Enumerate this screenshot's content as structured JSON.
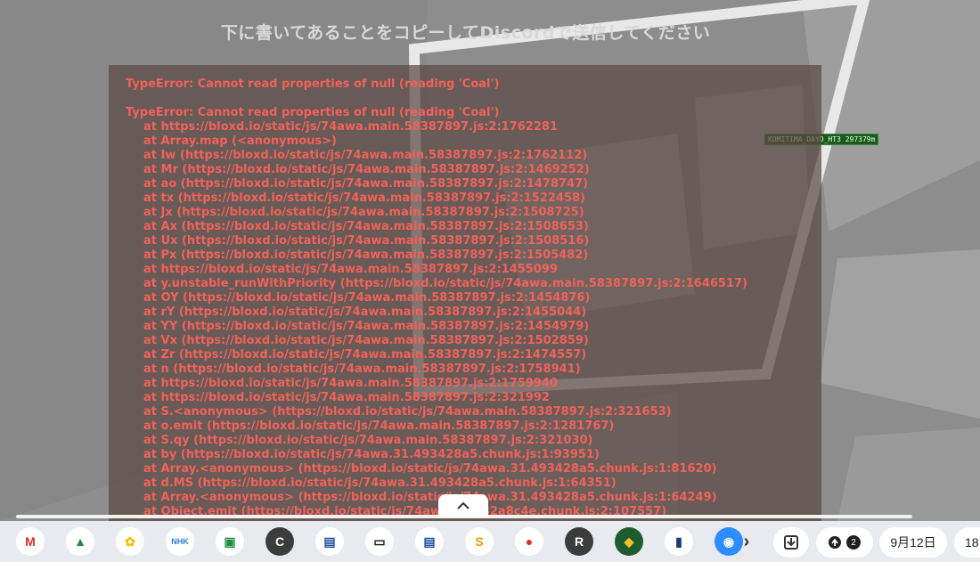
{
  "instruction": "下に書いてあることをコピーしてDiscordで送信してください",
  "nametag": "KOMITIMA_DAYO_HT3 297379m",
  "error": {
    "header": "TypeError: Cannot read properties of null (reading 'Coal')",
    "stack_title": "TypeError: Cannot read properties of null (reading 'Coal')",
    "stack": [
      "at https://bloxd.io/static/js/74awa.main.58387897.js:2:1762281",
      "at Array.map (<anonymous>)",
      "at Iw (https://bloxd.io/static/js/74awa.main.58387897.js:2:1762112)",
      "at Mr (https://bloxd.io/static/js/74awa.main.58387897.js:2:1469252)",
      "at ao (https://bloxd.io/static/js/74awa.main.58387897.js:2:1478747)",
      "at tx (https://bloxd.io/static/js/74awa.main.58387897.js:2:1522458)",
      "at Jx (https://bloxd.io/static/js/74awa.main.58387897.js:2:1508725)",
      "at Ax (https://bloxd.io/static/js/74awa.main.58387897.js:2:1508653)",
      "at Ux (https://bloxd.io/static/js/74awa.main.58387897.js:2:1508516)",
      "at Px (https://bloxd.io/static/js/74awa.main.58387897.js:2:1505482)",
      "at https://bloxd.io/static/js/74awa.main.58387897.js:2:1455099",
      "at y.unstable_runWithPriority (https://bloxd.io/static/js/74awa.main.58387897.js:2:1646517)",
      "at OY (https://bloxd.io/static/js/74awa.main.58387897.js:2:1454876)",
      "at rY (https://bloxd.io/static/js/74awa.main.58387897.js:2:1455044)",
      "at YY (https://bloxd.io/static/js/74awa.main.58387897.js:2:1454979)",
      "at Vx (https://bloxd.io/static/js/74awa.main.58387897.js:2:1502859)",
      "at Zr (https://bloxd.io/static/js/74awa.main.58387897.js:2:1474557)",
      "at n (https://bloxd.io/static/js/74awa.main.58387897.js:2:1758941)",
      "at https://bloxd.io/static/js/74awa.main.58387897.js:2:1759940",
      "at https://bloxd.io/static/js/74awa.main.58387897.js:2:321992",
      "at S.<anonymous> (https://bloxd.io/static/js/74awa.main.58387897.js:2:321653)",
      "at o.emit (https://bloxd.io/static/js/74awa.main.58387897.js:2:1281767)",
      "at S.qy (https://bloxd.io/static/js/74awa.main.58387897.js:2:321030)",
      "at by (https://bloxd.io/static/js/74awa.31.493428a5.chunk.js:1:93951)",
      "at Array.<anonymous> (https://bloxd.io/static/js/74awa.31.493428a5.chunk.js:1:81620)",
      "at d.MS (https://bloxd.io/static/js/74awa.31.493428a5.chunk.js:1:64351)",
      "at Array.<anonymous> (https://bloxd.io/static/js/74awa.31.493428a5.chunk.js:1:64249)",
      "at Object.emit (https://bloxd.io/static/js/74awa.32.282a8c4e.chunk.js:2:107557)"
    ]
  },
  "shelf": {
    "apps": [
      {
        "name": "gmail-icon",
        "label": "M",
        "bg": "#ffffff",
        "fg": "#d93025"
      },
      {
        "name": "google-drive-icon",
        "label": "▲",
        "bg": "#ffffff",
        "fg": "#1e8e3e"
      },
      {
        "name": "google-photos-icon",
        "label": "✿",
        "bg": "#ffffff",
        "fg": "#fbbc04"
      },
      {
        "name": "nhk-for-school-icon",
        "label": "NHK",
        "bg": "#ffffff",
        "fg": "#2b7bd6"
      },
      {
        "name": "google-classroom-icon",
        "label": "▣",
        "bg": "#ffffff",
        "fg": "#1e8e3e"
      },
      {
        "name": "app-c-icon",
        "label": "C",
        "bg": "#3c3c3c",
        "fg": "#ffffff"
      },
      {
        "name": "window-app-icon",
        "label": "▤",
        "bg": "#ffffff",
        "fg": "#1a4fa0"
      },
      {
        "name": "game-controller-icon",
        "label": "▭",
        "bg": "#ffffff",
        "fg": "#111111"
      },
      {
        "name": "window-app-2-icon",
        "label": "▤",
        "bg": "#ffffff",
        "fg": "#1a4fa0"
      },
      {
        "name": "s-app-icon",
        "label": "S",
        "bg": "#ffffff",
        "fg": "#f29900"
      },
      {
        "name": "camera-app-icon",
        "label": "●",
        "bg": "#ffffff",
        "fg": "#d93025"
      },
      {
        "name": "app-r-icon",
        "label": "R",
        "bg": "#3c3c3c",
        "fg": "#ffffff"
      },
      {
        "name": "school-app-icon",
        "label": "◆",
        "bg": "#1d5c2e",
        "fg": "#f6c026"
      },
      {
        "name": "book-app-icon",
        "label": "▮",
        "bg": "#ffffff",
        "fg": "#1a3d7a"
      },
      {
        "name": "zoom-icon",
        "label": "◉",
        "bg": "#2d8cff",
        "fg": "#ffffff"
      }
    ],
    "overflow_arrow": "›",
    "notification_count": "2",
    "date": "9月12日",
    "time": "18"
  }
}
